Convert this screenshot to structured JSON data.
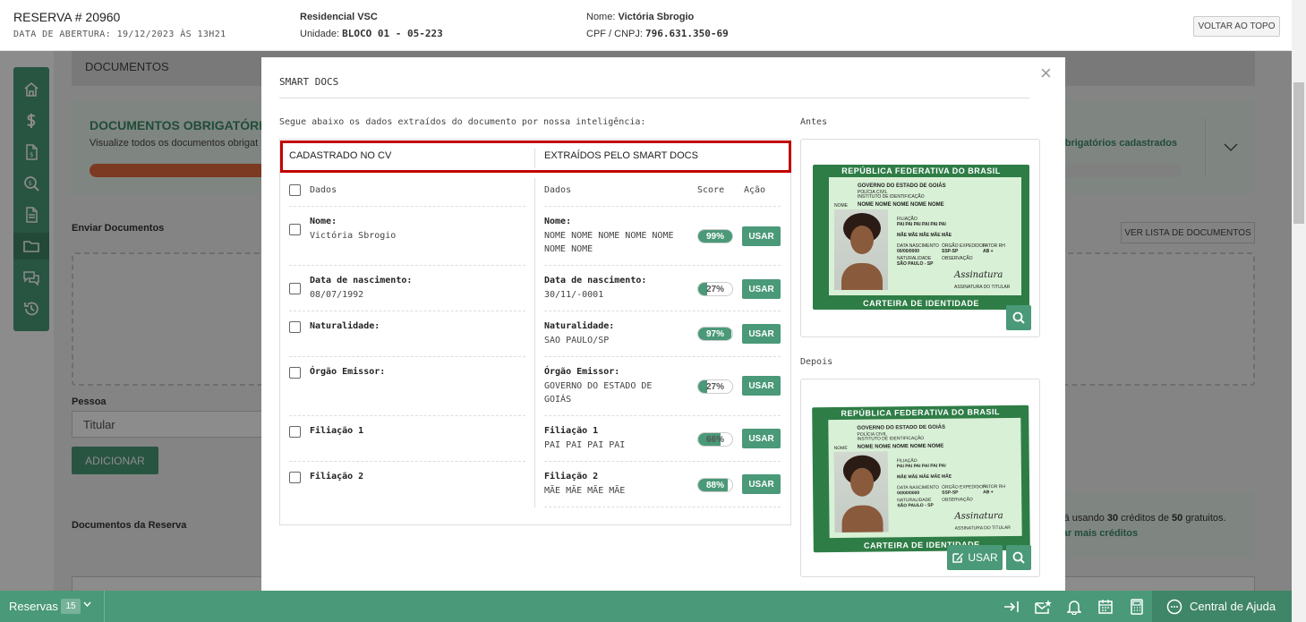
{
  "header": {
    "title": "RESERVA # 20960",
    "opening_label": "DATA DE ABERTURA: 19/12/2023 ÀS 13H21",
    "project": "Residencial VSC",
    "unit_label": "Unidade:",
    "unit_value": "BLOCO 01 - 05-223",
    "name_label": "Nome:",
    "name_value": "Victória Sbrogio",
    "cpf_label": "CPF / CNPJ:",
    "cpf_value": "796.631.350-69",
    "back_top_button": "VOLTAR AO TOPO"
  },
  "sidebar": {
    "items": [
      {
        "icon": "home-icon"
      },
      {
        "icon": "dollar-icon"
      },
      {
        "icon": "invoice-icon"
      },
      {
        "icon": "search-dollar-icon"
      },
      {
        "icon": "document-icon"
      },
      {
        "icon": "folder-icon",
        "active": true
      },
      {
        "icon": "chat-icon"
      },
      {
        "icon": "history-icon"
      }
    ]
  },
  "page": {
    "section_title": "DOCUMENTOS",
    "required_title": "DOCUMENTOS OBRIGATÓRIO",
    "required_sub": "Visualize todos os documentos obrigat",
    "required_right": "obrigatórios cadastrados",
    "send_label": "Enviar Documentos",
    "view_list_button": "VER LISTA DE DOCUMENTOS",
    "person_label": "Pessoa",
    "person_value": "Titular",
    "add_button": "ADICIONAR",
    "reserve_docs_label": "Documentos da Reserva",
    "credits_prefix": "stá usando ",
    "credits_used": "30",
    "credits_mid": " créditos de ",
    "credits_total": "50",
    "credits_suffix": " gratuitos.",
    "credits_link": "ltar mais créditos"
  },
  "modal": {
    "title": "SMART DOCS",
    "close": "×",
    "intro": "Segue abaixo os dados extraídos do documento por nossa inteligência:",
    "before_label": "Antes",
    "after_label": "Depois",
    "col_cv": "CADASTRADO NO CV",
    "col_sd": "EXTRAÍDOS PELO SMART DOCS",
    "head_dados_left": "Dados",
    "head_dados_right": "Dados",
    "head_score": "Score",
    "head_acao": "Ação",
    "usar": "USAR",
    "rows": [
      {
        "label": "Nome:",
        "cv": "Victória Sbrogio",
        "sd_label": "Nome:",
        "sd": "NOME NOME NOME NOME NOME NOME NOME",
        "score": "99%",
        "score_value": 99
      },
      {
        "label": "Data de nascimento:",
        "cv": "08/07/1992",
        "sd_label": "Data de nascimento:",
        "sd": "30/11/-0001",
        "score": "27%",
        "score_value": 27
      },
      {
        "label": "Naturalidade:",
        "cv": "",
        "sd_label": "Naturalidade:",
        "sd": "SAO PAULO/SP",
        "score": "97%",
        "score_value": 97
      },
      {
        "label": "Órgão Emissor:",
        "cv": "",
        "sd_label": "Órgão Emissor:",
        "sd": "GOVERNO DO ESTADO DE GOIÁS",
        "score": "27%",
        "score_value": 27
      },
      {
        "label": "Filiação 1",
        "cv": "",
        "sd_label": "Filiação 1",
        "sd": "PAI PAI PAI PAI",
        "score": "66%",
        "score_value": 66
      },
      {
        "label": "Filiação 2",
        "cv": "",
        "sd_label": "Filiação 2",
        "sd": "MÃE MÃE MÃE MÃE",
        "score": "88%",
        "score_value": 88
      }
    ],
    "id_card": {
      "top_band": "REPÚBLICA FEDERATIVA DO BRASIL",
      "bottom_band": "CARTEIRA DE IDENTIDADE",
      "gov": "GOVERNO DO ESTADO DE GOIÁS",
      "police": "POLÍCIA CIVIL",
      "institute": "INSTITUTO DE IDENTIFICAÇÃO",
      "nome_lbl": "NOME",
      "nome": "NOME NOME NOME NOME NOME",
      "filiacao_lbl": "FILIAÇÃO",
      "pai": "PAI PAI PAI PAI PAI PAI",
      "mae": "MÃE MÃE MÃE MÃE MÃE",
      "nasc_lbl": "DATA NASCIMENTO",
      "nasc": "00/00/0000",
      "orgao_lbl": "ÓRGÃO EXPEDIDOR",
      "orgao": "SSP-SP",
      "fator_lbl": "FATOR RH",
      "fator": "AB +",
      "natural_lbl": "NATURALIDADE",
      "natural": "SÃO PAULO - SP",
      "obs_lbl": "OBSERVAÇÃO",
      "signature": "Assinatura",
      "sign_lbl": "ASSINATURA DO TITULAR",
      "side": "BRASIL"
    },
    "after_usar": "USAR"
  },
  "bottom_bar": {
    "reservas_label": "Reservas",
    "reservas_count": "15",
    "help": "Central de Ajuda"
  },
  "colors": {
    "brand_green": "#4a9978",
    "highlight_red": "#c00000",
    "warning_orange": "#e06a3d"
  }
}
